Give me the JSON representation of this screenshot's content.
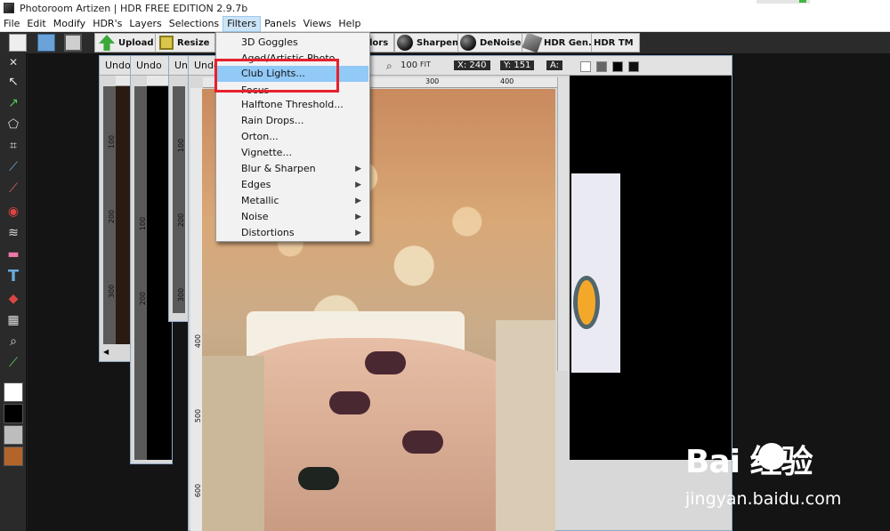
{
  "window": {
    "title": "Photoroom Artizen | HDR FREE EDITION 2.9.7b"
  },
  "menubar": {
    "items": [
      "File",
      "Edit",
      "Modify",
      "HDR's",
      "Layers",
      "Selections",
      "Filters",
      "Panels",
      "Views",
      "Help"
    ],
    "active": "Filters"
  },
  "toolbar": {
    "upload": "Upload",
    "resize": "Resize",
    "colors": "lors",
    "sharpen": "Sharpen",
    "denoise": "DeNoise",
    "hdrgen": "HDR Gen.",
    "hdrtm": "HDR TM"
  },
  "docs": {
    "undo_label": "Undo",
    "readout_x": "X: 240",
    "readout_y": "Y: 151",
    "readout_a": "A:",
    "zoom": "100",
    "fit": "FIT",
    "ruler_h": [
      "300",
      "400"
    ],
    "ruler_v1": [
      "100",
      "200",
      "300"
    ],
    "ruler_v2": [
      "100",
      "200"
    ],
    "ruler_v3": [
      "100",
      "200",
      "300"
    ],
    "ruler_v4": [
      "400",
      "500",
      "600"
    ]
  },
  "filters_menu": {
    "items": [
      {
        "label": "3D Goggles",
        "submenu": false
      },
      {
        "label": "Aged/Artistic Photo",
        "submenu": false
      },
      {
        "label": "Club Lights...",
        "submenu": false,
        "highlighted": true
      },
      {
        "label": "Focus",
        "submenu": false
      },
      {
        "label": "Halftone Threshold...",
        "submenu": false
      },
      {
        "label": "Rain Drops...",
        "submenu": false
      },
      {
        "label": "Orton...",
        "submenu": false
      },
      {
        "label": "Vignette...",
        "submenu": false
      },
      {
        "label": "Blur & Sharpen",
        "submenu": true
      },
      {
        "label": "Edges",
        "submenu": true
      },
      {
        "label": "Metallic",
        "submenu": true
      },
      {
        "label": "Noise",
        "submenu": true
      },
      {
        "label": "Distortions",
        "submenu": true
      }
    ]
  },
  "watermark": {
    "brand": "Bai 经验",
    "url": "jingyan.baidu.com"
  },
  "colors": {
    "highlight": "#91c9f7",
    "annotation": "#e8202c",
    "window_border": "#8fa9c9"
  }
}
